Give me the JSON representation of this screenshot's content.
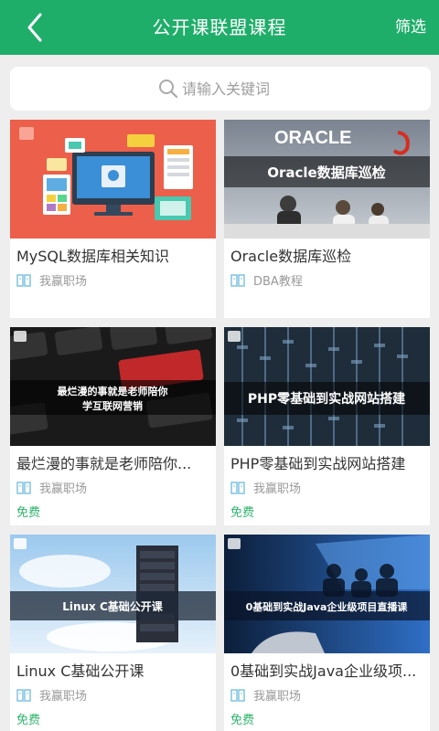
{
  "header": {
    "title": "公开课联盟课程",
    "filter_label": "筛选"
  },
  "search": {
    "placeholder": "请输入关键词"
  },
  "courses": [
    {
      "title": "MySQL数据库相关知识",
      "source": "我赢职场",
      "price": "",
      "banner": ""
    },
    {
      "title": "Oracle数据库巡检",
      "source": "DBA教程",
      "price": "",
      "banner": "Oracle数据库巡检",
      "logo": "ORACLE"
    },
    {
      "title": "最烂漫的事就是老师陪你...",
      "source": "我赢职场",
      "price": "免费",
      "banner_line1": "最烂漫的事就是老师陪你",
      "banner_line2": "学互联网营销"
    },
    {
      "title": "PHP零基础到实战网站搭建",
      "source": "我赢职场",
      "price": "免费",
      "banner": "PHP零基础到实战网站搭建"
    },
    {
      "title": "Linux C基础公开课",
      "source": "我赢职场",
      "price": "免费",
      "banner": "Linux C基础公开课"
    },
    {
      "title": "0基础到实战Java企业级项...",
      "source": "我赢职场",
      "price": "免费",
      "banner": "0基础到实战Java企业级项目直播课"
    }
  ],
  "colors": {
    "header_bg": "#1fae6a",
    "free_text": "#2db36b",
    "page_bg": "#eeeeee"
  },
  "icons": {
    "back": "back-arrow-icon",
    "search": "search-icon",
    "source": "book-icon"
  }
}
